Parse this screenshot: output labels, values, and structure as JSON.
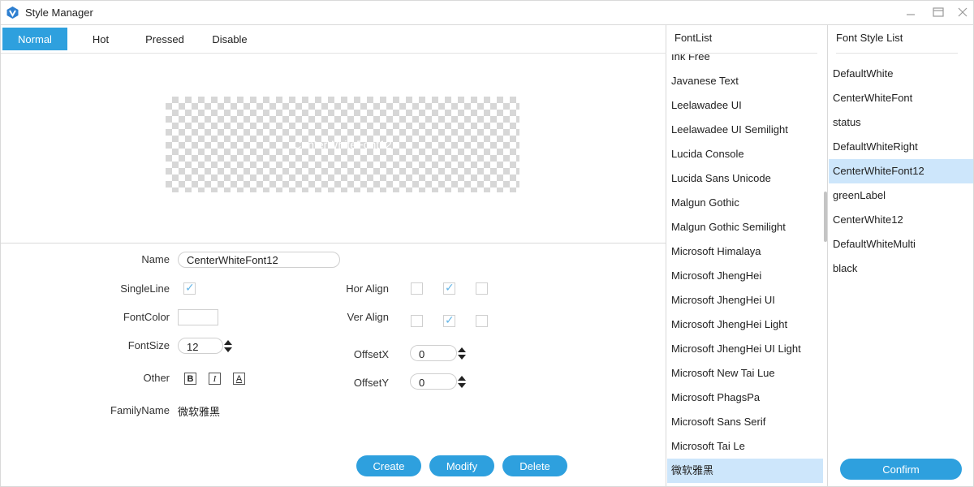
{
  "window": {
    "title": "Style Manager",
    "icons": {
      "app": "app-logo-icon",
      "minimize": "minimize-icon",
      "maximize": "maximize-icon",
      "close": "close-icon"
    }
  },
  "tabs": [
    {
      "label": "Normal",
      "active": true
    },
    {
      "label": "Hot",
      "active": false
    },
    {
      "label": "Pressed",
      "active": false
    },
    {
      "label": "Disable",
      "active": false
    }
  ],
  "preview": {
    "text": "CenterWhiteFont12"
  },
  "form": {
    "name_label": "Name",
    "name_value": "CenterWhiteFont12",
    "singleline_label": "SingleLine",
    "singleline_checked": true,
    "fontcolor_label": "FontColor",
    "fontcolor_value": "#ffffff",
    "fontsize_label": "FontSize",
    "fontsize_value": "12",
    "other_label": "Other",
    "bold_label": "B",
    "italic_label": "I",
    "underline_label": "A",
    "familyname_label": "FamilyName",
    "familyname_value": "微软雅黑",
    "horalign_label": "Hor Align",
    "horalign_options": [
      false,
      true,
      false
    ],
    "veralign_label": "Ver Align",
    "veralign_options": [
      false,
      true,
      false
    ],
    "offsetx_label": "OffsetX",
    "offsetx_value": "0",
    "offsety_label": "OffsetY",
    "offsety_value": "0"
  },
  "buttons": {
    "create": "Create",
    "modify": "Modify",
    "delete": "Delete",
    "confirm": "Confirm"
  },
  "fontlist": {
    "title": "FontList",
    "items": [
      "Ink Free",
      "Javanese Text",
      "Leelawadee UI",
      "Leelawadee UI Semilight",
      "Lucida Console",
      "Lucida Sans Unicode",
      "Malgun Gothic",
      "Malgun Gothic Semilight",
      "Microsoft Himalaya",
      "Microsoft JhengHei",
      "Microsoft JhengHei UI",
      "Microsoft JhengHei Light",
      "Microsoft JhengHei UI Light",
      "Microsoft New Tai Lue",
      "Microsoft PhagsPa",
      "Microsoft Sans Serif",
      "Microsoft Tai Le",
      "微软雅黑"
    ],
    "selected_index": 17
  },
  "stylelist": {
    "title": "Font Style List",
    "items": [
      "DefaultWhite",
      "CenterWhiteFont",
      "status",
      "DefaultWhiteRight",
      "CenterWhiteFont12",
      "greenLabel",
      "CenterWhite12",
      "DefaultWhiteMulti",
      "black"
    ],
    "selected_index": 4
  },
  "colors": {
    "accent": "#2ea0de",
    "selection": "#cde6fb",
    "check": "#64b5e6"
  }
}
